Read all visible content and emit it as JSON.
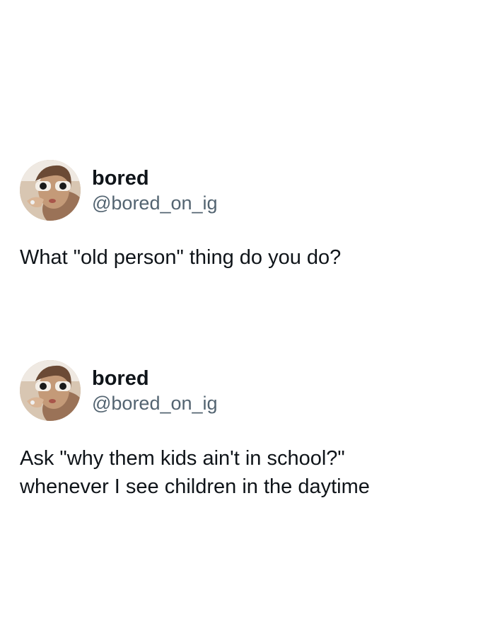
{
  "posts": [
    {
      "author": {
        "display_name": "bored",
        "handle": "@bored_on_ig",
        "avatar_icon": "profile-photo-woman-sunglasses"
      },
      "text": "What \"old person\" thing do you do?"
    },
    {
      "author": {
        "display_name": "bored",
        "handle": "@bored_on_ig",
        "avatar_icon": "profile-photo-woman-sunglasses"
      },
      "text": "Ask \"why them kids ain't in school?\"\nwhenever I see children in the daytime"
    }
  ],
  "colors": {
    "background": "#ffffff",
    "text_primary": "#0f1419",
    "text_secondary": "#536471"
  }
}
